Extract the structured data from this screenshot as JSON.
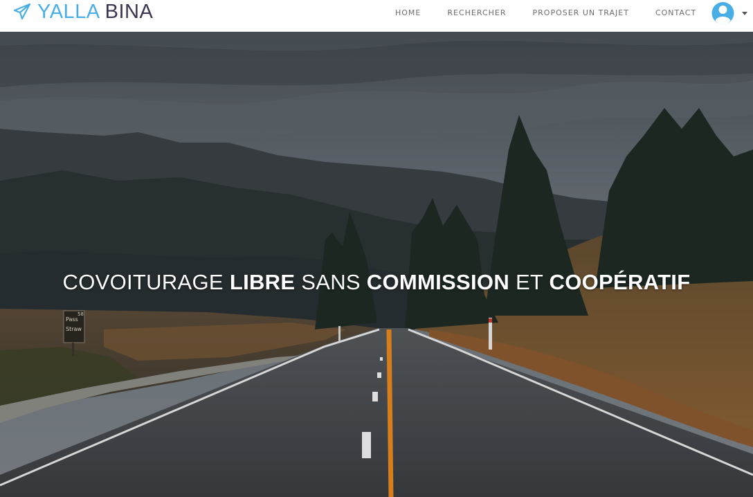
{
  "brand": {
    "word1": "YALLA",
    "word2": "BINA",
    "icon": "paper-plane-icon"
  },
  "nav": {
    "items": [
      {
        "label": "HOME"
      },
      {
        "label": "RECHERCHER"
      },
      {
        "label": "PROPOSER UN TRAJET"
      },
      {
        "label": "CONTACT"
      }
    ],
    "user_icon": "user-avatar-icon",
    "dropdown_icon": "caret-down-icon"
  },
  "hero": {
    "headline": {
      "p1": "COVOITURAGE",
      "p2": "LIBRE",
      "p3": "SANS",
      "p4": "COMMISSION",
      "p5": "ET",
      "p6": "COOPÉRATIF"
    },
    "sign": {
      "line1": "Pass",
      "line2": "Straw",
      "number": "58"
    }
  },
  "colors": {
    "brand_blue": "#4aaee6",
    "brand_dark": "#3c3450",
    "nav_text": "#6c6c6c",
    "road_line": "#e8891e"
  }
}
